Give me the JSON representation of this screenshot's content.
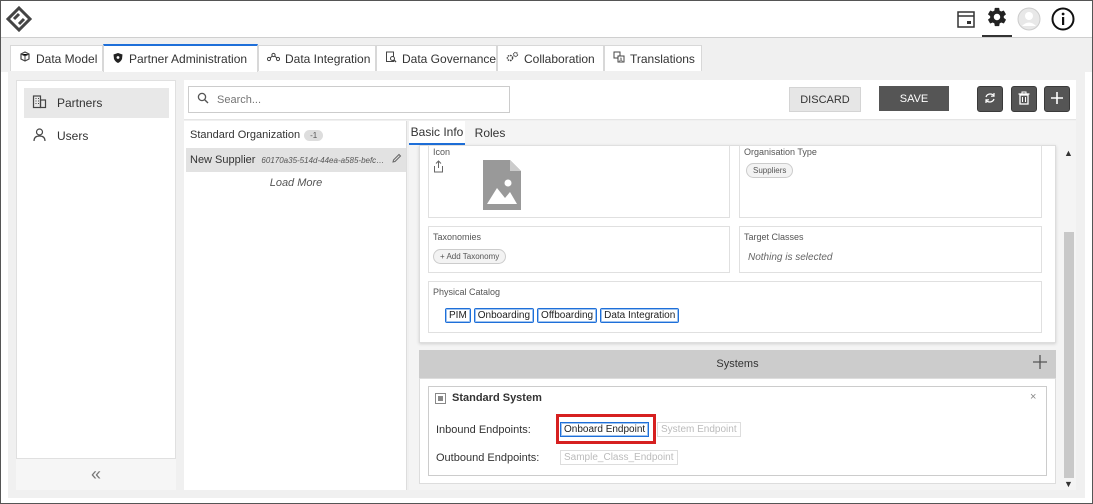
{
  "header": {
    "logo": "app-logo",
    "icons": [
      "calendar-icon",
      "gear-icon",
      "user-avatar-icon",
      "info-icon"
    ]
  },
  "tabs": [
    {
      "label": "Data Model",
      "icon": "cubes-icon"
    },
    {
      "label": "Partner Administration",
      "icon": "shield-icon",
      "active": true
    },
    {
      "label": "Data Integration",
      "icon": "nodes-icon"
    },
    {
      "label": "Data Governance",
      "icon": "doc-search-icon"
    },
    {
      "label": "Collaboration",
      "icon": "gears-icon"
    },
    {
      "label": "Translations",
      "icon": "translate-icon"
    }
  ],
  "sidebar": {
    "items": [
      {
        "label": "Partners",
        "icon": "buildings-icon",
        "active": true
      },
      {
        "label": "Users",
        "icon": "user-icon"
      }
    ],
    "collapse_glyph": "«"
  },
  "toolbar": {
    "search_placeholder": "Search...",
    "discard_label": "DISCARD",
    "save_label": "SAVE"
  },
  "partner_list": {
    "group_label": "Standard Organization",
    "group_count": "-1",
    "rows": [
      {
        "name": "New Supplier",
        "id": "60170a35-514d-44ea-a585-befc8..."
      }
    ],
    "load_more": "Load More"
  },
  "detail": {
    "tabs": [
      {
        "label": "Basic Info",
        "active": true
      },
      {
        "label": "Roles"
      }
    ],
    "icon_label": "Icon",
    "organisation_type_label": "Organisation Type",
    "organisation_type_value": "Suppliers",
    "taxonomies_label": "Taxonomies",
    "add_taxonomy": "+ Add Taxonomy",
    "target_classes_label": "Target Classes",
    "target_classes_value": "Nothing is selected",
    "physical_catalog_label": "Physical Catalog",
    "catalog_tags": [
      "PIM",
      "Onboarding",
      "Offboarding",
      "Data Integration"
    ]
  },
  "systems": {
    "title": "Systems",
    "system_name": "Standard System",
    "inbound_label": "Inbound Endpoints:",
    "inbound_endpoints": [
      "Onboard Endpoint",
      "System Endpoint"
    ],
    "outbound_label": "Outbound Endpoints:",
    "outbound_endpoints": [
      "Sample_Class_Endpoint"
    ],
    "highlight_color": "#d62020"
  },
  "colors": {
    "accent": "#1e6fd9",
    "button_dark": "#555555"
  }
}
